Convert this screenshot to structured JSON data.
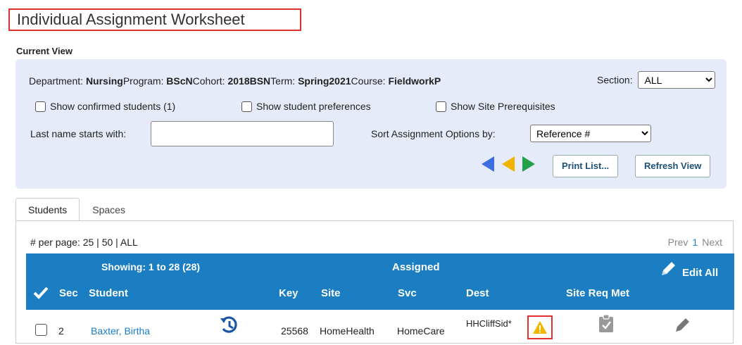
{
  "page": {
    "title": "Individual Assignment Worksheet",
    "current_view_label": "Current View"
  },
  "filters": {
    "department_label": "Department:",
    "department_value": "Nursing",
    "program_label": "Program:",
    "program_value": "BScN",
    "cohort_label": "Cohort:",
    "cohort_value": "2018BSN",
    "term_label": "Term:",
    "term_value": "Spring2021",
    "course_label": "Course:",
    "course_value": "FieldworkP",
    "section_label": "Section:",
    "section_value": "ALL",
    "show_confirmed_label": "Show confirmed students (1)",
    "show_preferences_label": "Show student preferences",
    "show_prereqs_label": "Show Site Prerequisites",
    "lastname_label": "Last name starts with:",
    "lastname_value": "",
    "sort_label": "Sort Assignment Options by:",
    "sort_value": "Reference #",
    "print_label": "Print List...",
    "refresh_label": "Refresh View",
    "arrow_colors": {
      "first": "#3b6fe0",
      "second": "#f0b400",
      "third": "#23a04a"
    }
  },
  "tabs": [
    {
      "label": "Students",
      "active": true
    },
    {
      "label": "Spaces",
      "active": false
    }
  ],
  "list": {
    "per_page": "# per page: 25 | 50 | ALL",
    "pager": {
      "prev": "Prev",
      "current": "1",
      "next": "Next"
    },
    "showing": "Showing: 1 to 28 (28)",
    "assigned": "Assigned",
    "edit_all": "Edit All",
    "columns": {
      "sec": "Sec",
      "student": "Student",
      "key": "Key",
      "site": "Site",
      "svc": "Svc",
      "dest": "Dest",
      "site_req_met": "Site Req Met"
    },
    "rows": [
      {
        "sec": "2",
        "student": "Baxter, Birtha",
        "key": "25568",
        "site": "HomeHealth",
        "svc": "HomeCare",
        "dest": "HHCliffSid*"
      }
    ]
  },
  "colors": {
    "header_blue": "#1b7ec2",
    "panel_bg": "#e6ebfa",
    "warning": "#f2b600",
    "highlight_red": "#e03030"
  }
}
